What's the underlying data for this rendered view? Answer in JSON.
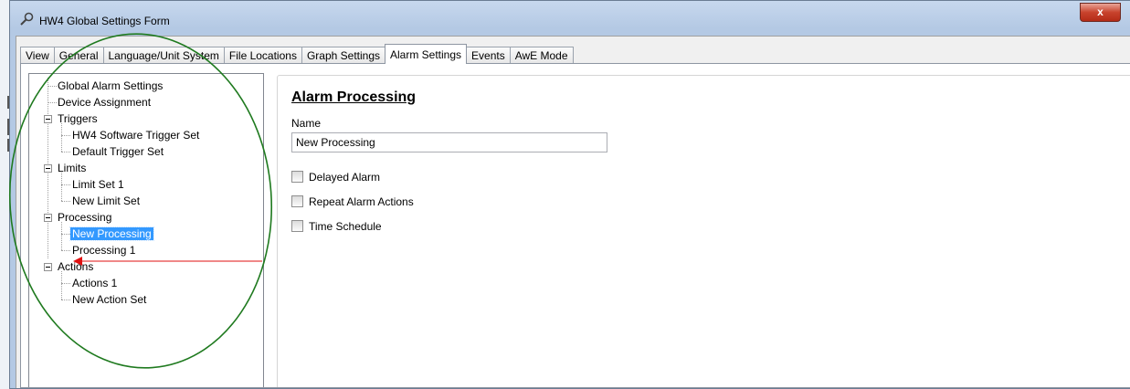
{
  "window": {
    "title": "HW4 Global Settings Form",
    "close_label": "x"
  },
  "tabs": [
    {
      "label": "View",
      "active": false
    },
    {
      "label": "General",
      "active": false
    },
    {
      "label": "Language/Unit System",
      "active": false
    },
    {
      "label": "File Locations",
      "active": false
    },
    {
      "label": "Graph Settings",
      "active": false
    },
    {
      "label": "Alarm Settings",
      "active": true
    },
    {
      "label": "Events",
      "active": false
    },
    {
      "label": "AwE Mode",
      "active": false
    }
  ],
  "tree": [
    {
      "label": "Global Alarm Settings"
    },
    {
      "label": "Device Assignment"
    },
    {
      "label": "Triggers"
    },
    {
      "label": "HW4 Software Trigger Set"
    },
    {
      "label": "Default Trigger Set"
    },
    {
      "label": "Limits"
    },
    {
      "label": "Limit Set 1"
    },
    {
      "label": "New Limit Set"
    },
    {
      "label": "Processing"
    },
    {
      "label": "New Processing"
    },
    {
      "label": "Processing 1"
    },
    {
      "label": "Actions"
    },
    {
      "label": "Actions 1"
    },
    {
      "label": "New Action Set"
    }
  ],
  "detail": {
    "title": "Alarm Processing",
    "name_label": "Name",
    "name_value": "New Processing",
    "checkboxes": [
      {
        "label": "Delayed Alarm",
        "checked": false
      },
      {
        "label": "Repeat Alarm Actions",
        "checked": false
      },
      {
        "label": "Time Schedule",
        "checked": false
      }
    ]
  },
  "annotation": {
    "ellipse_color": "#1f7a1f",
    "arrow_color": "#e01010"
  }
}
